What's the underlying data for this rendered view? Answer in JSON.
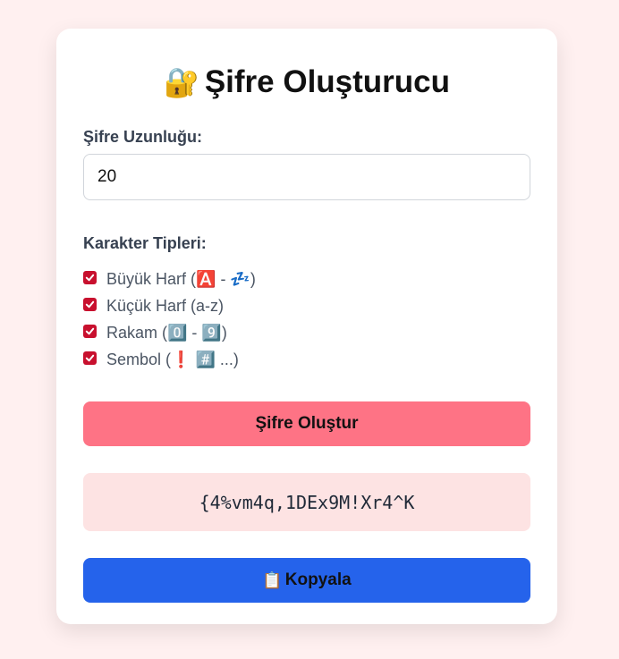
{
  "app": {
    "title_icon": "🔐",
    "title": "Şifre Oluşturucu"
  },
  "length": {
    "label": "Şifre Uzunluğu:",
    "value": "20"
  },
  "types": {
    "label": "Karakter Tipleri:",
    "options": [
      {
        "label": "Büyük Harf (🅰️ - 💤)",
        "checked": true
      },
      {
        "label": "Küçük Harf (a-z)",
        "checked": true
      },
      {
        "label": "Rakam (0️⃣ - 9️⃣)",
        "checked": true
      },
      {
        "label": "Sembol (❗ #️⃣ ...)",
        "checked": true
      }
    ]
  },
  "generate": {
    "label": "Şifre Oluştur"
  },
  "result": {
    "password": "{4%vm4q,1DEx9M!Xr4^K"
  },
  "copy": {
    "icon": "📋",
    "label": "Kopyala"
  },
  "colors": {
    "page_bg": "#fff0f0",
    "generate_button": "#fe7385",
    "result_bg": "#fde3e3",
    "copy_button": "#2563eb",
    "checkbox": "#c8102e"
  }
}
